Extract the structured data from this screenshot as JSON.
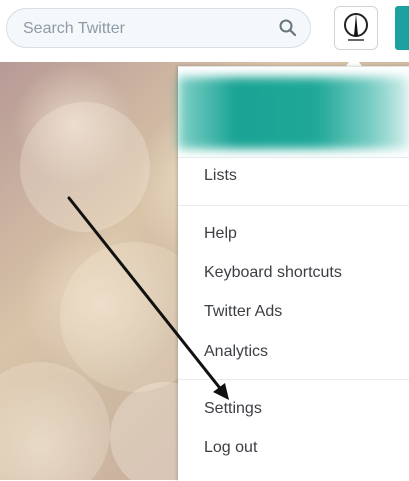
{
  "search": {
    "placeholder": "Search Twitter"
  },
  "menu": {
    "items": [
      {
        "label": "Lists"
      },
      {
        "label": "Help"
      },
      {
        "label": "Keyboard shortcuts"
      },
      {
        "label": "Twitter Ads"
      },
      {
        "label": "Analytics"
      },
      {
        "label": "Settings"
      },
      {
        "label": "Log out"
      }
    ]
  },
  "colors": {
    "accent": "#1da1a0",
    "banner": "#18a394"
  },
  "icons": {
    "search": "search-icon",
    "avatar": "avatar-icon",
    "annotation": "arrow-annotation"
  }
}
